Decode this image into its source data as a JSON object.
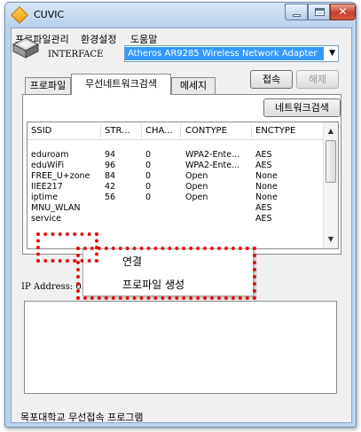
{
  "window": {
    "title": "CUVIC"
  },
  "menu": {
    "items": [
      "프로파일관리",
      "환경설정",
      "도움말"
    ]
  },
  "interface": {
    "label": "INTERFACE",
    "selected": "Atheros AR9285 Wireless Network Adapter"
  },
  "buttons": {
    "connect": "접속",
    "disconnect": "해제",
    "scan": "네트워크검색"
  },
  "tabs": [
    "프로파일",
    "무선네트워크검색",
    "메세지"
  ],
  "table": {
    "headers": [
      "SSID",
      "STR...",
      "CHA...",
      "CONTYPE",
      "ENCTYPE"
    ],
    "rows": [
      [
        "eduroam",
        "94",
        "0",
        "WPA2-Ente...",
        "AES"
      ],
      [
        "eduWiFi",
        "96",
        "0",
        "WPA2-Ente...",
        "AES"
      ],
      [
        "FREE_U+zone",
        "84",
        "0",
        "Open",
        "None"
      ],
      [
        "IIEE217",
        "42",
        "0",
        "Open",
        "None"
      ],
      [
        "iptime",
        "56",
        "0",
        "Open",
        "None"
      ],
      [
        "MNU_WLAN",
        "",
        "",
        "",
        "AES"
      ],
      [
        "service",
        "",
        "",
        "",
        "AES"
      ]
    ]
  },
  "context_menu": {
    "items": [
      "연결",
      "프로파일 생성"
    ]
  },
  "ip": {
    "label": "IP Address: 0.0.0.0"
  },
  "status": {
    "text": "목포대학교 무선접속 프로그램"
  },
  "colors": {
    "selection": "#3399ff",
    "highlight": "#e11111",
    "title_bar": "#bcd3ec"
  }
}
